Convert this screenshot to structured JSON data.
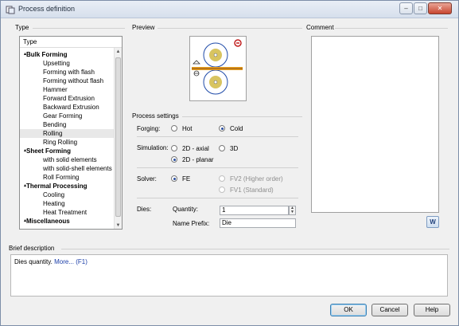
{
  "window": {
    "title": "Process definition"
  },
  "sections": {
    "type": "Type",
    "preview": "Preview",
    "comment": "Comment",
    "process_settings": "Process settings",
    "brief_description": "Brief description"
  },
  "tree": {
    "header": "Type",
    "items": [
      {
        "label": "Bulk Forming",
        "kind": "cat"
      },
      {
        "label": "Upsetting",
        "kind": "sub"
      },
      {
        "label": "Forming with flash",
        "kind": "sub"
      },
      {
        "label": "Forming without flash",
        "kind": "sub"
      },
      {
        "label": "Hammer",
        "kind": "sub"
      },
      {
        "label": "Forward Extrusion",
        "kind": "sub"
      },
      {
        "label": "Backward Extrusion",
        "kind": "sub"
      },
      {
        "label": "Gear Forming",
        "kind": "sub"
      },
      {
        "label": "Bending",
        "kind": "sub"
      },
      {
        "label": "Rolling",
        "kind": "sub",
        "selected": true
      },
      {
        "label": "Ring Rolling",
        "kind": "sub"
      },
      {
        "label": "Sheet Forming",
        "kind": "cat"
      },
      {
        "label": "with solid elements",
        "kind": "sub"
      },
      {
        "label": "with solid-shell elements",
        "kind": "sub"
      },
      {
        "label": "Roll Forming",
        "kind": "sub"
      },
      {
        "label": "Thermal Processing",
        "kind": "cat"
      },
      {
        "label": "Cooling",
        "kind": "sub"
      },
      {
        "label": "Heating",
        "kind": "sub"
      },
      {
        "label": "Heat Treatment",
        "kind": "sub"
      },
      {
        "label": "Miscellaneous",
        "kind": "cat"
      }
    ]
  },
  "settings": {
    "forging": {
      "label": "Forging:",
      "hot": "Hot",
      "cold": "Cold",
      "selected": "Cold"
    },
    "simulation": {
      "label": "Simulation:",
      "axial": "2D - axial",
      "planar": "2D - planar",
      "three_d": "3D",
      "selected": "2D - planar"
    },
    "solver": {
      "label": "Solver:",
      "fe": "FE",
      "fv2": "FV2 (Higher order)",
      "fv1": "FV1 (Standard)",
      "selected": "FE"
    },
    "dies": {
      "label": "Dies:",
      "quantity_label": "Quantity:",
      "quantity_value": "1",
      "prefix_label": "Name Prefix:",
      "prefix_value": "Die"
    }
  },
  "brief": {
    "text": "Dies quantity.",
    "more": "More... (F1)"
  },
  "buttons": {
    "ok": "OK",
    "cancel": "Cancel",
    "help": "Help",
    "w": "W"
  },
  "colors": {
    "roller": "#d8c460",
    "roller_outline": "#1e4aa8",
    "accent_red": "#c22020"
  }
}
